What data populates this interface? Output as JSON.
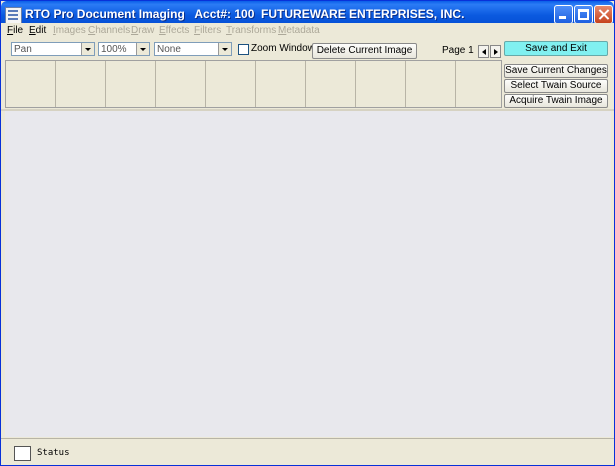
{
  "window": {
    "title": "RTO Pro Document Imaging   Acct#: 100  FUTUREWARE ENTERPRISES, INC."
  },
  "menu": [
    {
      "label": "File",
      "enabled": true
    },
    {
      "label": "Edit",
      "enabled": true
    },
    {
      "label": "Images",
      "enabled": false
    },
    {
      "label": "Channels",
      "enabled": false
    },
    {
      "label": "Draw",
      "enabled": false
    },
    {
      "label": "Effects",
      "enabled": false
    },
    {
      "label": "Filters",
      "enabled": false
    },
    {
      "label": "Transforms",
      "enabled": false
    },
    {
      "label": "Metadata",
      "enabled": false
    }
  ],
  "toolbar": {
    "tool_select": "Pan",
    "zoom_select": "100%",
    "mode_select": "None",
    "zoom_window_label": "Zoom Window",
    "zoom_window_checked": false,
    "delete_label": "Delete Current Image",
    "page_label": "Page 1"
  },
  "side_buttons": {
    "save_exit": "Save and Exit",
    "save_changes": "Save Current Changes",
    "select_twain": "Select Twain Source",
    "acquire_twain": "Acquire Twain Image"
  },
  "status": {
    "text": "Status"
  },
  "colors": {
    "accent_save_exit": "#80f0f0",
    "titlebar": "#0a5ee8",
    "canvas": "#e8e8ed"
  }
}
